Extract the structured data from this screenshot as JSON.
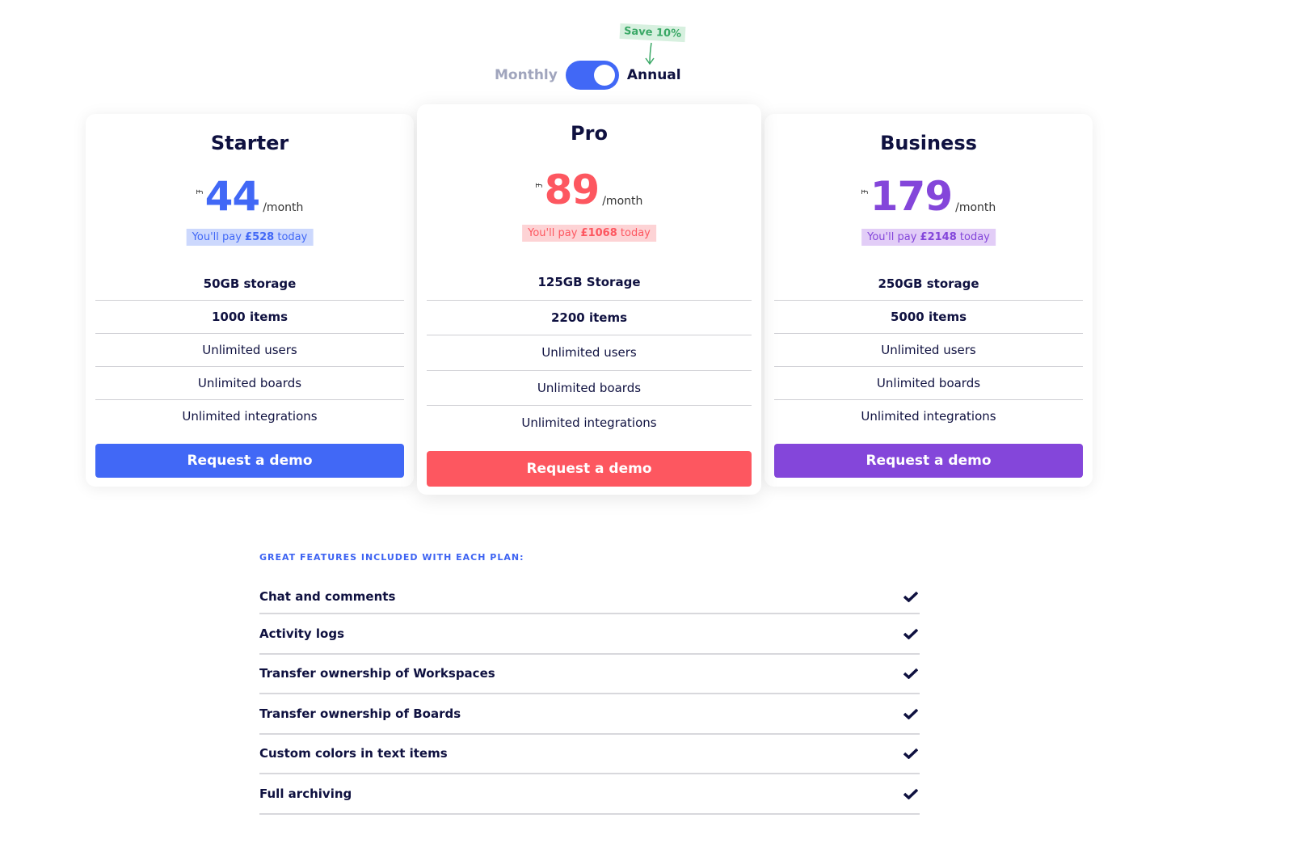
{
  "billing": {
    "monthly_label": "Monthly",
    "annual_label": "Annual",
    "selected": "annual",
    "save_badge": "Save 10%"
  },
  "colors": {
    "starter": "#4168f6",
    "pro": "#fd5760",
    "business": "#8446da",
    "text": "#0f1140",
    "toggle": "#4168f6",
    "save_badge": "#3aa866"
  },
  "plans": [
    {
      "name": "Starter",
      "currency": "£",
      "amount": "44",
      "period": "/month",
      "pay_prefix": "You'll pay ",
      "pay_amount": "£528",
      "pay_suffix": " today",
      "features": [
        "50GB storage",
        "1000 items",
        "Unlimited users",
        "Unlimited boards",
        "Unlimited integrations"
      ],
      "cta": "Request a demo"
    },
    {
      "name": "Pro",
      "currency": "£",
      "amount": "89",
      "period": "/month",
      "pay_prefix": "You'll pay ",
      "pay_amount": "£1068",
      "pay_suffix": " today",
      "features": [
        "125GB Storage",
        "2200 items",
        "Unlimited users",
        "Unlimited boards",
        "Unlimited integrations"
      ],
      "cta": "Request a demo"
    },
    {
      "name": "Business",
      "currency": "£",
      "amount": "179",
      "period": "/month",
      "pay_prefix": "You'll pay ",
      "pay_amount": "£2148",
      "pay_suffix": " today",
      "features": [
        "250GB storage",
        "5000 items",
        "Unlimited users",
        "Unlimited boards",
        "Unlimited integrations"
      ],
      "cta": "Request a demo"
    }
  ],
  "included": {
    "title": "GREAT FEATURES INCLUDED WITH EACH PLAN:",
    "items": [
      {
        "label": "Chat and comments",
        "icon": "check-icon"
      },
      {
        "label": "Activity logs",
        "icon": "check-icon"
      },
      {
        "label": "Transfer ownership of Workspaces",
        "icon": "check-icon"
      },
      {
        "label": "Transfer ownership of Boards",
        "icon": "check-icon"
      },
      {
        "label": "Custom colors in text items",
        "icon": "check-icon"
      },
      {
        "label": "Full archiving",
        "icon": "check-icon"
      }
    ]
  }
}
